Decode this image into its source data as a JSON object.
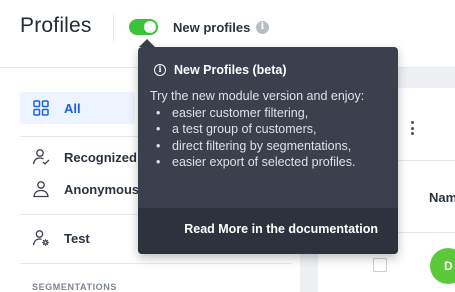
{
  "header": {
    "title": "Profiles",
    "toggle_label": "New profiles",
    "toggle_on": true,
    "info_glyph": "i"
  },
  "sidebar": {
    "items": [
      {
        "label": "All",
        "icon": "grid-icon",
        "active": true
      },
      {
        "label": "Recognized",
        "icon": "user-check-icon"
      },
      {
        "label": "Anonymous",
        "icon": "user-icon"
      },
      {
        "label": "Test",
        "icon": "user-gear-icon"
      }
    ],
    "section_label": "SEGMENTATIONS"
  },
  "table": {
    "column_header": "Nam",
    "avatar_initial": "D"
  },
  "tooltip": {
    "info_glyph": "i",
    "title": "New Profiles (beta)",
    "intro": "Try the new module version and enjoy:",
    "bullets": [
      "easier customer filtering,",
      "a test group of customers,",
      "direct filtering by segmentations,",
      "easier export of selected profiles."
    ],
    "link": "Read More in the documentation"
  },
  "colors": {
    "accent": "#1a63e8",
    "toggle_on": "#3ac43a",
    "tooltip_bg": "#3a414c",
    "avatar": "#5cc93b"
  }
}
